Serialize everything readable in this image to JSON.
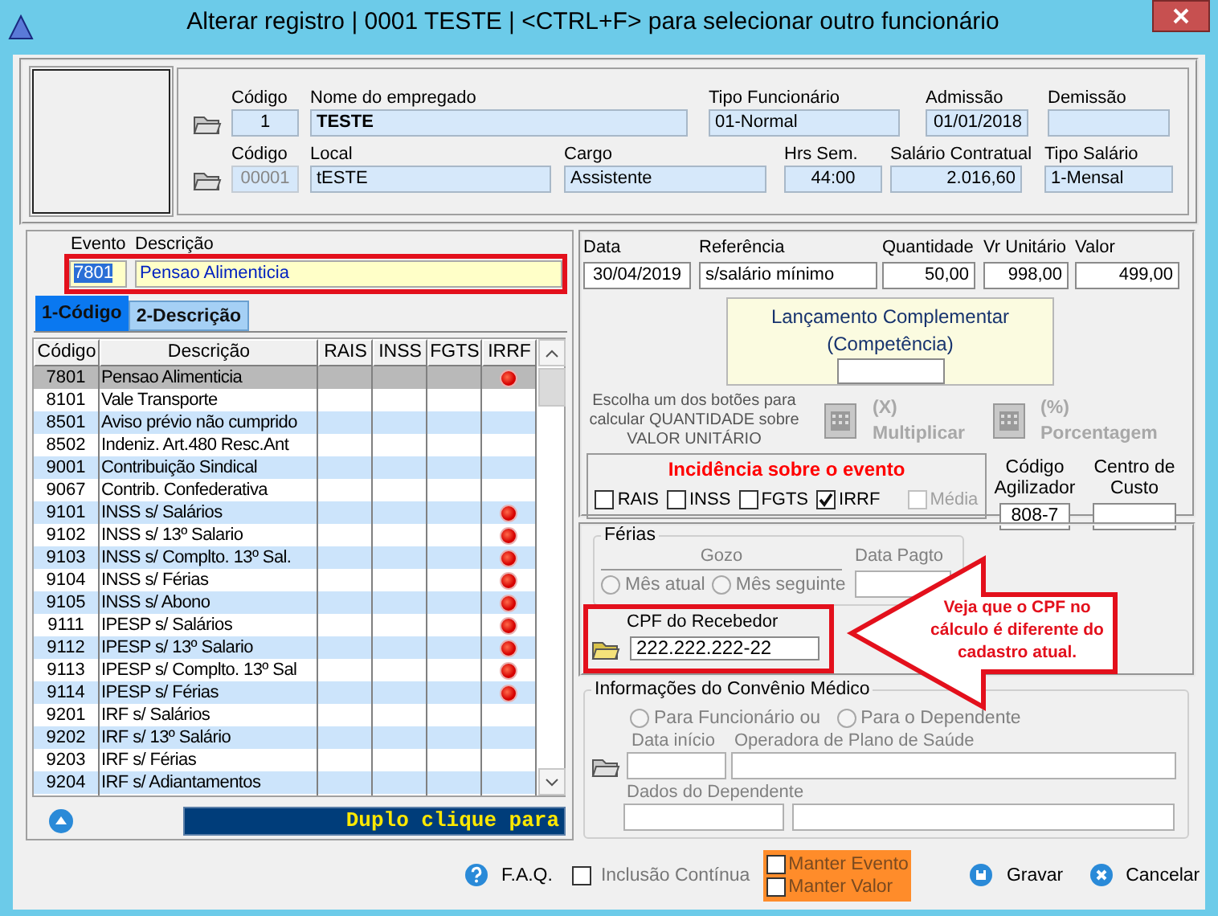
{
  "window": {
    "title": "Alterar registro | 0001 TESTE | <CTRL+F> para selecionar outro funcionário"
  },
  "employee": {
    "row_1": [
      {
        "label": "Código",
        "value": "1",
        "disabled": false
      },
      {
        "label": "Nome do empregado",
        "value": "TESTE",
        "disabled": false
      },
      {
        "label": "Tipo Funcionário",
        "value": "01-Normal",
        "disabled": false
      },
      {
        "label": "Admissão",
        "value": "01/01/2018",
        "disabled": false
      },
      {
        "label": "Demissão",
        "disabled": false
      }
    ],
    "row_2": [
      {
        "label": "Código",
        "value": "00001",
        "disabled": true
      },
      {
        "label": "Local",
        "value": "tESTE",
        "disabled": false
      },
      {
        "label": "Cargo",
        "value": "Assistente",
        "disabled": false
      },
      {
        "label": "Hrs Sem.",
        "value": "44:00",
        "disabled": false
      },
      {
        "label": "Salário Contratual",
        "value": "2.016,60",
        "disabled": false
      },
      {
        "label": "Tipo Salário",
        "value": "1-Mensal",
        "disabled": false
      }
    ]
  },
  "event": {
    "code_label": "Evento",
    "description_label": "Descrição",
    "code": "7801",
    "description": "Pensao Alimenticia"
  },
  "tabs": [
    {
      "label": "1-Código",
      "selected": true
    },
    {
      "label": "2-Descrição",
      "selected": false
    }
  ],
  "event_table": {
    "columns": [
      "Código",
      "Descrição",
      "RAIS",
      "INSS",
      "FGTS",
      "IRRF"
    ],
    "rows": [
      {
        "code": "7801",
        "description": "Pensao Alimenticia",
        "irrf": true,
        "selected": true
      },
      {
        "code": "8101",
        "description": "Vale Transporte",
        "irrf": false,
        "selected": false
      },
      {
        "code": "8501",
        "description": "Aviso prévio não cumprido",
        "irrf": false,
        "selected": false
      },
      {
        "code": "8502",
        "description": "Indeniz. Art.480 Resc.Ant",
        "irrf": false,
        "selected": false
      },
      {
        "code": "9001",
        "description": "Contribuição Sindical",
        "irrf": false,
        "selected": false
      },
      {
        "code": "9067",
        "description": "Contrib. Confederativa",
        "irrf": false,
        "selected": false
      },
      {
        "code": "9101",
        "description": "INSS s/ Salários",
        "irrf": true,
        "selected": false
      },
      {
        "code": "9102",
        "description": "INSS s/ 13º Salario",
        "irrf": true,
        "selected": false
      },
      {
        "code": "9103",
        "description": "INSS s/ Complto. 13º Sal.",
        "irrf": true,
        "selected": false
      },
      {
        "code": "9104",
        "description": "INSS s/ Férias",
        "irrf": true,
        "selected": false
      },
      {
        "code": "9105",
        "description": "INSS s/ Abono",
        "irrf": true,
        "selected": false
      },
      {
        "code": "9111",
        "description": "IPESP s/ Salários",
        "irrf": true,
        "selected": false
      },
      {
        "code": "9112",
        "description": "IPESP s/ 13º Salario",
        "irrf": true,
        "selected": false
      },
      {
        "code": "9113",
        "description": "IPESP s/ Complto. 13º Sal",
        "irrf": true,
        "selected": false
      },
      {
        "code": "9114",
        "description": "IPESP s/ Férias",
        "irrf": true,
        "selected": false
      },
      {
        "code": "9201",
        "description": "IRF s/ Salários",
        "irrf": false,
        "selected": false
      },
      {
        "code": "9202",
        "description": "IRF s/ 13º Salário",
        "irrf": false,
        "selected": false
      },
      {
        "code": "9203",
        "description": "IRF s/ Férias",
        "irrf": false,
        "selected": false
      },
      {
        "code": "9204",
        "description": "IRF s/ Adiantamentos",
        "irrf": false,
        "selected": false
      }
    ],
    "footer_banner": "Duplo clique para"
  },
  "entry": {
    "fields": [
      {
        "label": "Data",
        "value": "30/04/2019"
      },
      {
        "label": "Referência",
        "value": "s/salário mínimo"
      },
      {
        "label": "Quantidade",
        "value": "50,00"
      },
      {
        "label": "Vr Unitário",
        "value": "998,00"
      },
      {
        "label": "Valor",
        "value": "499,00"
      }
    ]
  },
  "complement": {
    "title": "Lançamento Complementar",
    "subtitle": "(Competência)"
  },
  "calc": {
    "hint": "Escolha um dos botões para calcular QUANTIDADE sobre VALOR UNITÁRIO",
    "buttons": [
      {
        "symbol": "(X)",
        "label": "Multiplicar",
        "disabled": true
      },
      {
        "symbol": "(%)",
        "label": "Porcentagem",
        "disabled": true
      }
    ]
  },
  "incidence": {
    "title": "Incidência sobre o evento",
    "checks": [
      {
        "label": "RAIS",
        "checked": false,
        "disabled": false
      },
      {
        "label": "INSS",
        "checked": false,
        "disabled": false
      },
      {
        "label": "FGTS",
        "checked": false,
        "disabled": false
      },
      {
        "label": "IRRF",
        "checked": true,
        "disabled": false
      },
      {
        "label": "Média",
        "checked": false,
        "disabled": true
      }
    ]
  },
  "agilizador": {
    "label": "Código Agilizador",
    "value": "808-7"
  },
  "cost_center": {
    "label": "Centro de Custo"
  },
  "ferias": {
    "legend": "Férias",
    "gozo_label": "Gozo",
    "payment_label": "Data Pagto",
    "radios": [
      {
        "label": "Mês atual",
        "selected": false,
        "disabled": true
      },
      {
        "label": "Mês seguinte",
        "selected": false,
        "disabled": true
      }
    ]
  },
  "cpf": {
    "label": "CPF do Recebedor",
    "value": "222.222.222-22"
  },
  "convenio": {
    "legend": "Informações do Convênio Médico",
    "start_label": "Data início",
    "operator_label": "Operadora de Plano de Saúde",
    "dependent_label": "Dados do Dependente",
    "radios": [
      {
        "label": "Para Funcionário ou",
        "selected": false,
        "disabled": true
      },
      {
        "label": "Para o Dependente",
        "selected": false,
        "disabled": true
      }
    ]
  },
  "annotation": {
    "text": "Veja que o CPF no cálculo é diferente do cadastro atual."
  },
  "footer": {
    "faq": "F.A.Q.",
    "continuous": {
      "label": "Inclusão Contínua",
      "checked": false
    },
    "keep": [
      {
        "label": "Manter Evento",
        "checked": false
      },
      {
        "label": "Manter Valor",
        "checked": false
      }
    ],
    "save": "Gravar",
    "cancel": "Cancelar"
  }
}
